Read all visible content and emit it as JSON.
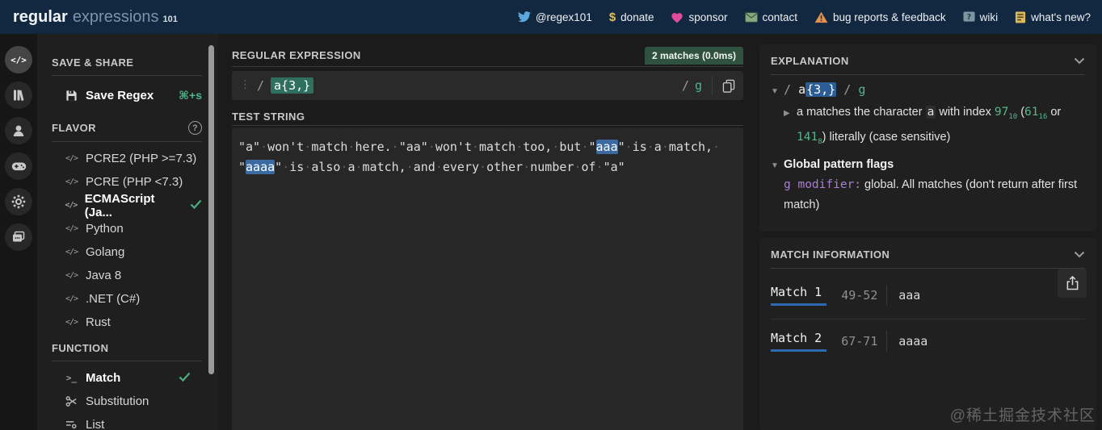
{
  "navbar": {
    "logo": {
      "part1": "regular",
      "part2": "expressions",
      "part3": "101"
    },
    "links": [
      {
        "label": "@regex101"
      },
      {
        "label": "donate"
      },
      {
        "label": "sponsor"
      },
      {
        "label": "contact"
      },
      {
        "label": "bug reports & feedback"
      },
      {
        "label": "wiki"
      },
      {
        "label": "what's new?"
      }
    ]
  },
  "sidebar": {
    "save_share_title": "SAVE & SHARE",
    "save_regex": {
      "label": "Save Regex",
      "shortcut": "⌘+s"
    },
    "flavor_title": "FLAVOR",
    "flavors": [
      {
        "label": "PCRE2 (PHP >=7.3)"
      },
      {
        "label": "PCRE (PHP <7.3)"
      },
      {
        "label": "ECMAScript (Ja..."
      },
      {
        "label": "Python"
      },
      {
        "label": "Golang"
      },
      {
        "label": "Java 8"
      },
      {
        "label": ".NET (C#)"
      },
      {
        "label": "Rust"
      }
    ],
    "function_title": "FUNCTION",
    "functions": [
      {
        "label": "Match"
      },
      {
        "label": "Substitution"
      },
      {
        "label": "List"
      }
    ]
  },
  "editor": {
    "regex_section_title": "REGULAR EXPRESSION",
    "match_badge": "2 matches (0.0ms)",
    "regex": {
      "open_delim": "/",
      "pattern": "a{3,}",
      "close_delim": "/",
      "flags": "g"
    },
    "test_string_title": "TEST STRING",
    "test_lines": [
      {
        "segments": [
          {
            "t": "\"a\" won't match here. \"aa\" won't match too, but \"",
            "m": false
          },
          {
            "t": "aaa",
            "m": true
          },
          {
            "t": "\" is a match, ",
            "m": false
          }
        ]
      },
      {
        "segments": [
          {
            "t": "\"",
            "m": false
          },
          {
            "t": "aaaa",
            "m": true
          },
          {
            "t": "\" is also a match, and every other number of \"a\"",
            "m": false
          }
        ]
      }
    ]
  },
  "explanation": {
    "title": "EXPLANATION",
    "pattern_row": {
      "open": "/ ",
      "atom": "a",
      "quantifier": "{3,}",
      "close": " / ",
      "flags": "g"
    },
    "char_row": {
      "t1": "a matches the character ",
      "code": "a",
      "t2": " with index ",
      "dec": "97",
      "dec_base": "10",
      "t3": " (",
      "hex": "61",
      "hex_base": "16",
      "t4": " or ",
      "oct": "141",
      "oct_base": "8",
      "t5": ") literally (case sensitive)"
    },
    "flags_row": {
      "title": "Global pattern flags",
      "modifier": "g modifier:",
      "text": " global. All matches (don't return after first match)"
    }
  },
  "match_info": {
    "title": "MATCH INFORMATION",
    "matches": [
      {
        "label": "Match 1",
        "range": "49-52",
        "value": "aaa"
      },
      {
        "label": "Match 2",
        "range": "67-71",
        "value": "aaaa"
      }
    ]
  },
  "watermark": "@稀土掘金技术社区"
}
